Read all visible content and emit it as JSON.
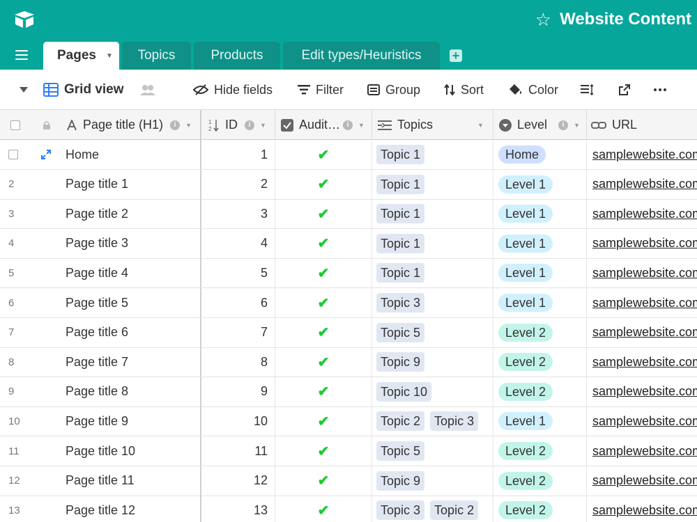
{
  "header": {
    "base_name": "Website Content",
    "colors": {
      "bar": "#07a69b",
      "tab_inactive": "#0f9188"
    }
  },
  "tabs": [
    {
      "label": "Pages",
      "active": true
    },
    {
      "label": "Topics",
      "active": false
    },
    {
      "label": "Products",
      "active": false
    },
    {
      "label": "Edit types/Heuristics",
      "active": false
    }
  ],
  "toolbar": {
    "view_name": "Grid view",
    "hide_fields": "Hide fields",
    "filter": "Filter",
    "group": "Group",
    "sort": "Sort",
    "color": "Color"
  },
  "columns": {
    "title": "Page title (H1)",
    "id": "ID",
    "audit": "Audit…",
    "topics": "Topics",
    "level": "Level",
    "url": "URL"
  },
  "level_colors": {
    "Home": "#cfdfff",
    "Level 1": "#d0f0fd",
    "Level 2": "#c2f5e9"
  },
  "rows": [
    {
      "num": "",
      "title": "Home",
      "id": "1",
      "audited": true,
      "topics": [
        "Topic 1"
      ],
      "level": "Home",
      "url": "samplewebsite.com"
    },
    {
      "num": "2",
      "title": "Page title 1",
      "id": "2",
      "audited": true,
      "topics": [
        "Topic 1"
      ],
      "level": "Level 1",
      "url": "samplewebsite.com"
    },
    {
      "num": "3",
      "title": "Page title 2",
      "id": "3",
      "audited": true,
      "topics": [
        "Topic 1"
      ],
      "level": "Level 1",
      "url": "samplewebsite.com"
    },
    {
      "num": "4",
      "title": "Page title 3",
      "id": "4",
      "audited": true,
      "topics": [
        "Topic 1"
      ],
      "level": "Level 1",
      "url": "samplewebsite.com"
    },
    {
      "num": "5",
      "title": "Page title 4",
      "id": "5",
      "audited": true,
      "topics": [
        "Topic 1"
      ],
      "level": "Level 1",
      "url": "samplewebsite.com"
    },
    {
      "num": "6",
      "title": "Page title 5",
      "id": "6",
      "audited": true,
      "topics": [
        "Topic 3"
      ],
      "level": "Level 1",
      "url": "samplewebsite.com"
    },
    {
      "num": "7",
      "title": "Page title 6",
      "id": "7",
      "audited": true,
      "topics": [
        "Topic 5"
      ],
      "level": "Level 2",
      "url": "samplewebsite.com"
    },
    {
      "num": "8",
      "title": "Page title 7",
      "id": "8",
      "audited": true,
      "topics": [
        "Topic 9"
      ],
      "level": "Level 2",
      "url": "samplewebsite.com"
    },
    {
      "num": "9",
      "title": "Page title 8",
      "id": "9",
      "audited": true,
      "topics": [
        "Topic 10"
      ],
      "level": "Level 2",
      "url": "samplewebsite.com"
    },
    {
      "num": "10",
      "title": "Page title 9",
      "id": "10",
      "audited": true,
      "topics": [
        "Topic 2",
        "Topic 3"
      ],
      "level": "Level 1",
      "url": "samplewebsite.com"
    },
    {
      "num": "11",
      "title": "Page title 10",
      "id": "11",
      "audited": true,
      "topics": [
        "Topic 5"
      ],
      "level": "Level 2",
      "url": "samplewebsite.com"
    },
    {
      "num": "12",
      "title": "Page title 11",
      "id": "12",
      "audited": true,
      "topics": [
        "Topic 9"
      ],
      "level": "Level 2",
      "url": "samplewebsite.com"
    },
    {
      "num": "13",
      "title": "Page title 12",
      "id": "13",
      "audited": true,
      "topics": [
        "Topic 3",
        "Topic 2"
      ],
      "level": "Level 2",
      "url": "samplewebsite.com"
    }
  ]
}
